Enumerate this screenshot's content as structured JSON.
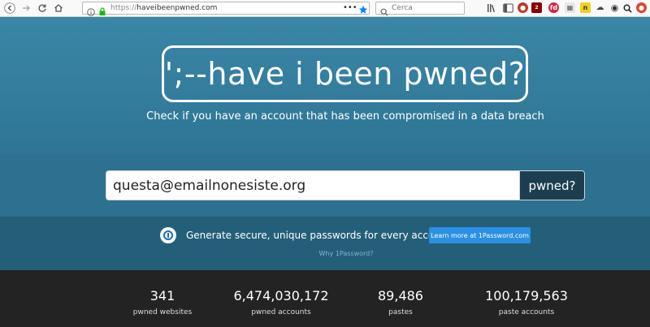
{
  "browser": {
    "url_scheme": "https://",
    "url_host": "haveibeenpwned.com",
    "search_placeholder": "Cerca",
    "ext_badge_1": "2",
    "ext_label_fd": "fd",
    "ext_label_n": "n"
  },
  "hero": {
    "logo_text": "';--have i been pwned?",
    "tagline": "Check if you have an account that has been compromised in a data breach"
  },
  "search": {
    "email_value": "questa@emailnonesiste.org",
    "button_label": "pwned?"
  },
  "promo": {
    "text": "Generate secure, unique passwords for every account",
    "button_label": "Learn more at 1Password.com",
    "why_link": "Why 1Password?",
    "accent_color": "#2b8fe4"
  },
  "stats": [
    {
      "value": "341",
      "label": "pwned websites"
    },
    {
      "value": "6,474,030,172",
      "label": "pwned accounts"
    },
    {
      "value": "89,486",
      "label": "pastes"
    },
    {
      "value": "100,179,563",
      "label": "paste accounts"
    }
  ]
}
